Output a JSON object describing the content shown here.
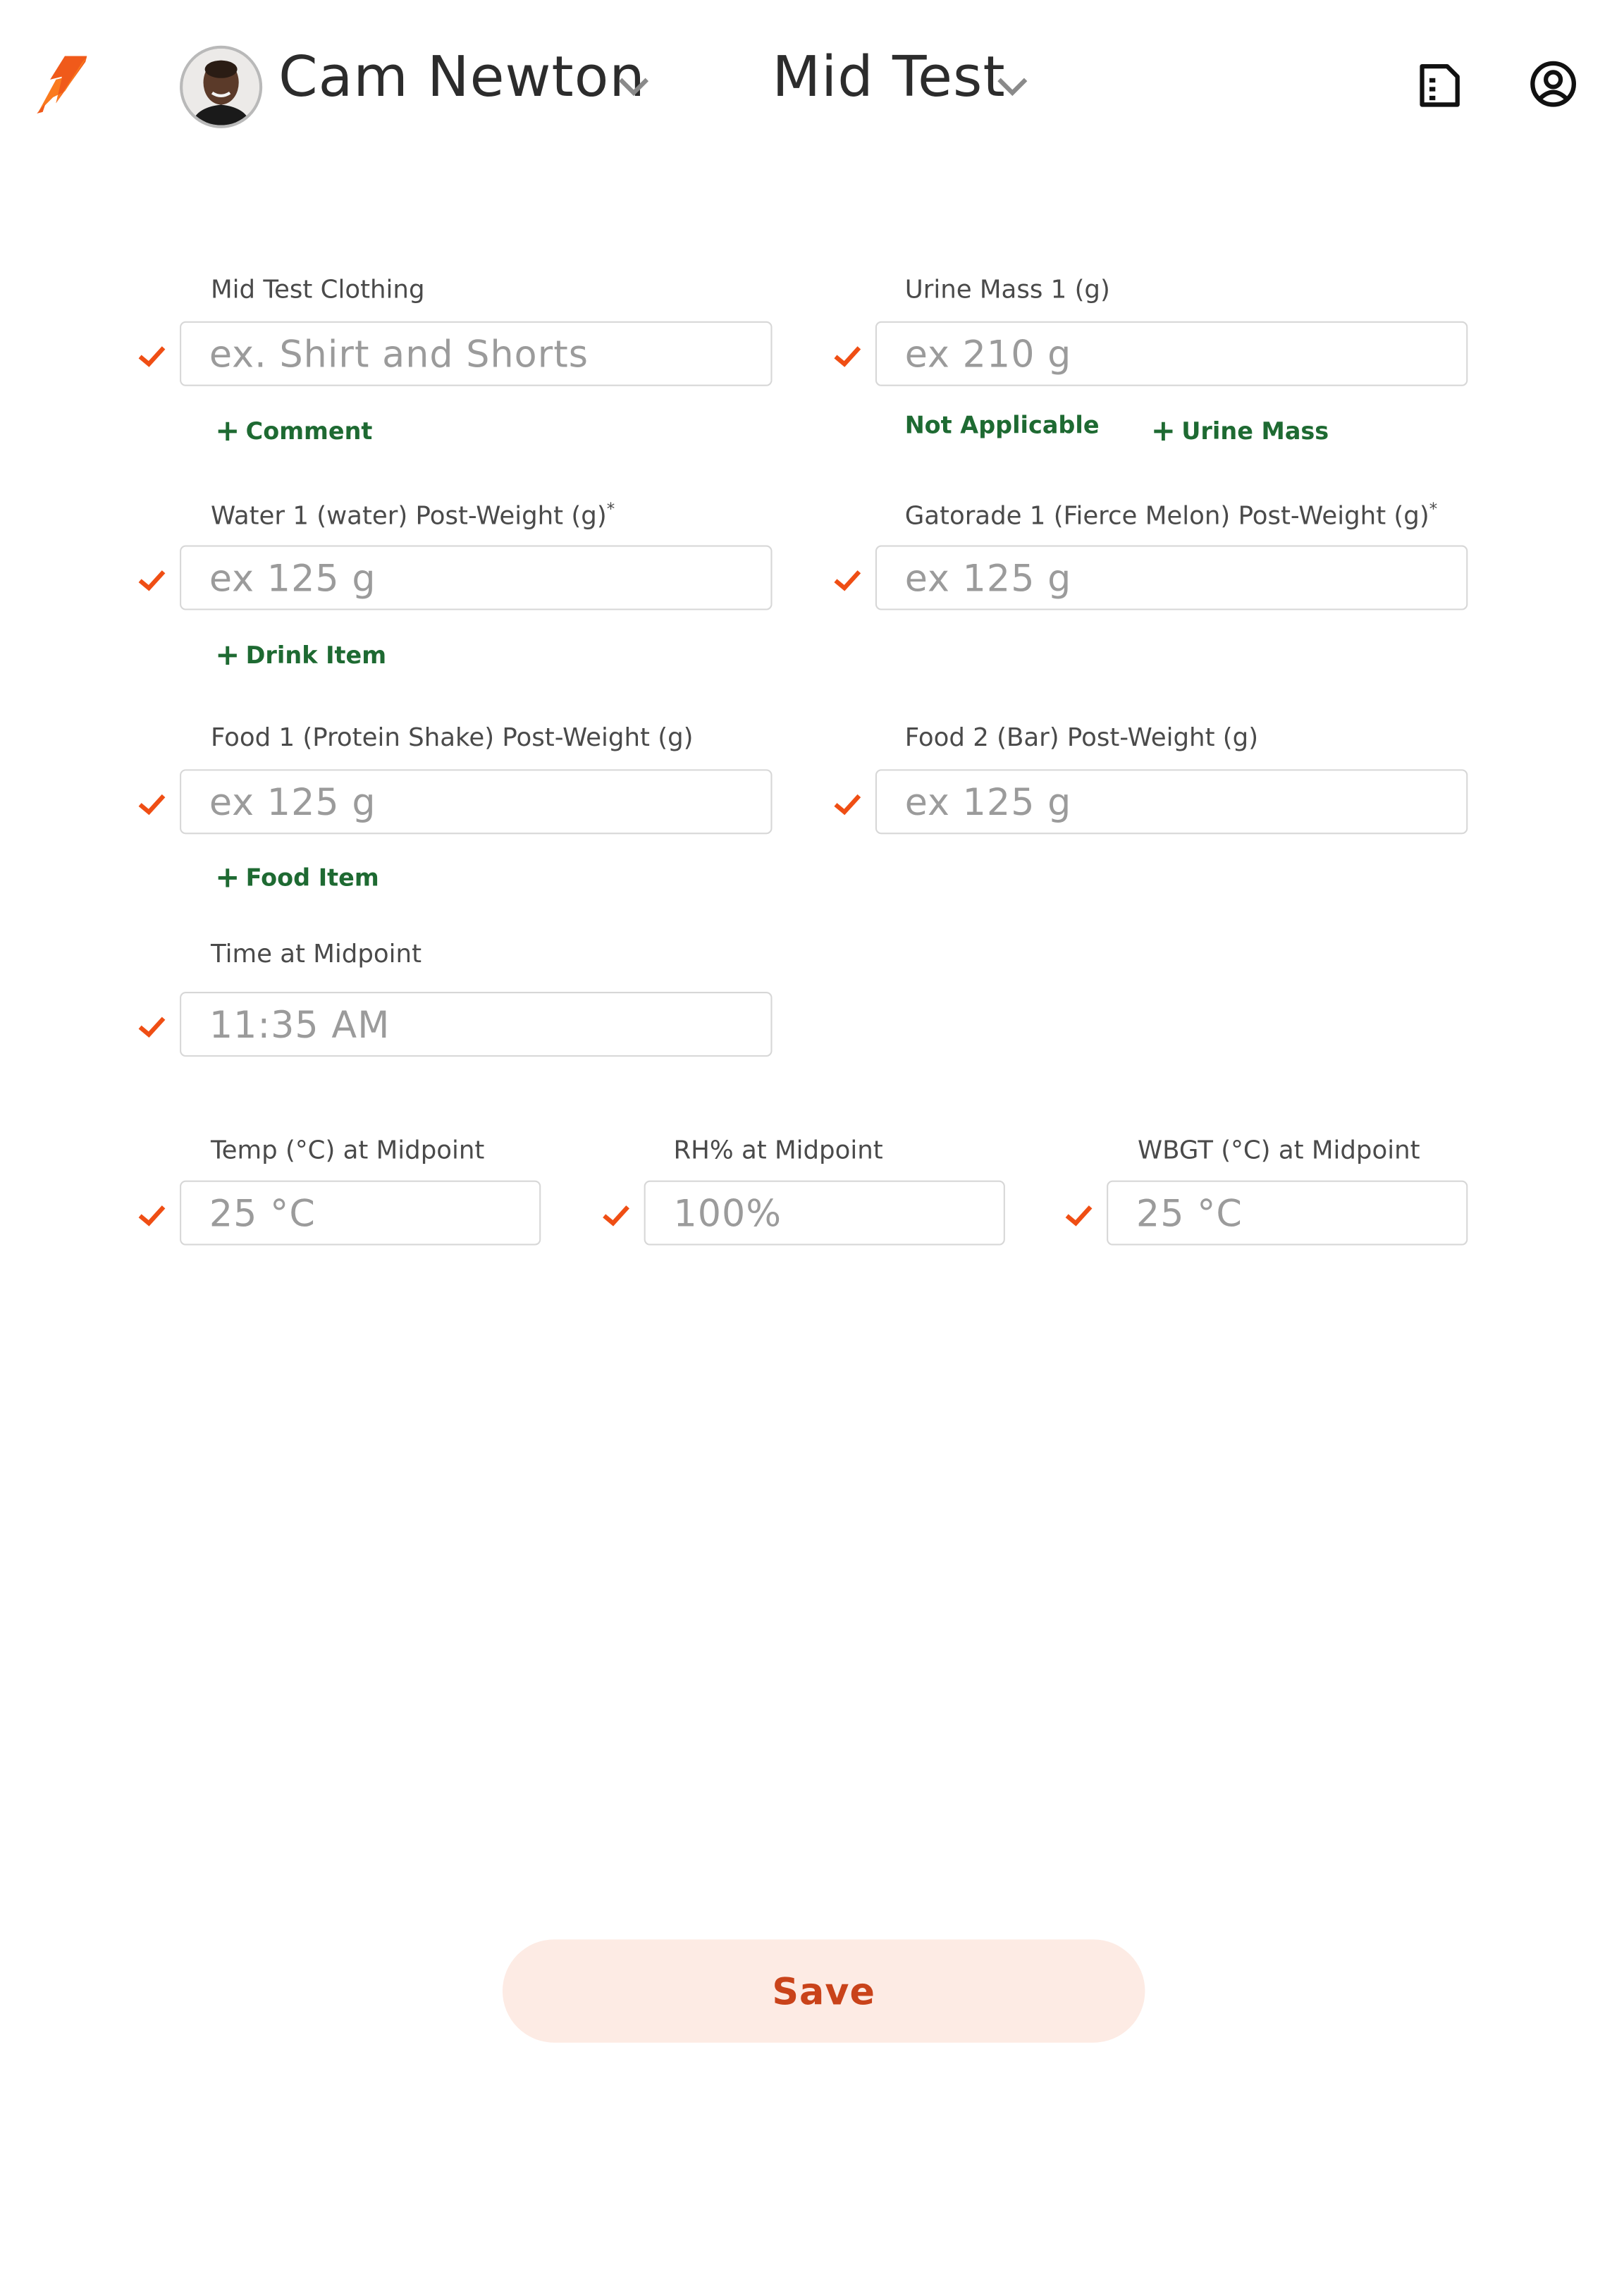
{
  "header": {
    "athlete_name": "Cam Newton",
    "stage": "Mid Test"
  },
  "fields": {
    "clothing": {
      "label": "Mid Test Clothing",
      "placeholder": "ex. Shirt and Shorts"
    },
    "urine": {
      "label": "Urine Mass 1 (g)",
      "placeholder": "ex 210 g"
    },
    "water": {
      "label": "Water 1 (water) Post-Weight (g)",
      "required_mark": "*",
      "placeholder": "ex 125 g"
    },
    "gatorade": {
      "label": "Gatorade 1 (Fierce Melon) Post-Weight (g)",
      "required_mark": "*",
      "placeholder": "ex 125 g"
    },
    "food1": {
      "label": "Food 1 (Protein Shake) Post-Weight (g)",
      "placeholder": "ex 125 g"
    },
    "food2": {
      "label": "Food 2 (Bar) Post-Weight (g)",
      "placeholder": "ex 125 g"
    },
    "time": {
      "label": "Time at Midpoint",
      "value": "11:35 AM"
    },
    "temp": {
      "label": "Temp (°C) at Midpoint",
      "placeholder": "25 °C"
    },
    "rh": {
      "label": "RH% at Midpoint",
      "placeholder": "100%"
    },
    "wbgt": {
      "label": "WBGT (°C) at Midpoint",
      "placeholder": "25 °C"
    }
  },
  "links": {
    "comment": "Comment",
    "not_applicable": "Not Applicable",
    "urine_mass": "Urine Mass",
    "drink_item": "Drink Item",
    "food_item": "Food Item",
    "plus": "+"
  },
  "save_label": "Save",
  "colors": {
    "check": "#ef4e14",
    "link_green": "#1e6a32",
    "save_bg": "#fdebe4",
    "save_text": "#c9431a"
  },
  "icons": {
    "logo": "gatorade-bolt-icon",
    "dropdown": "chevron-down-icon",
    "check": "checkmark-icon",
    "document": "document-list-icon",
    "profile": "user-circle-icon"
  }
}
